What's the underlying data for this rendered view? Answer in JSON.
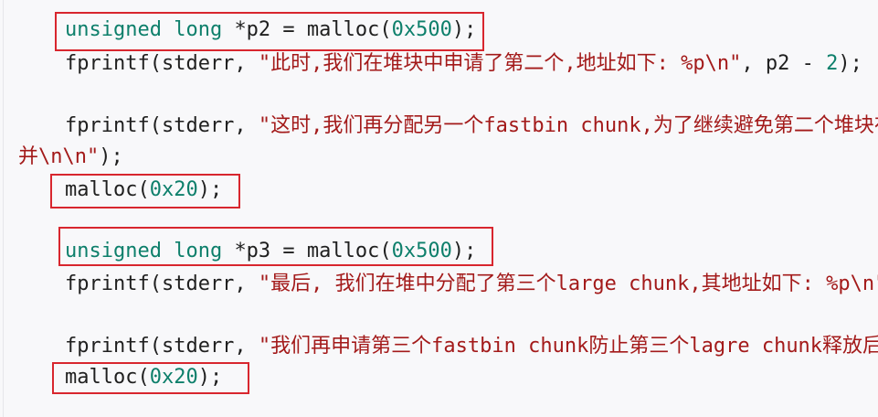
{
  "code_lines": [
    {
      "parts": [
        {
          "t": "unsigned long ",
          "c": "kw"
        },
        {
          "t": "*p2 = malloc(",
          "c": "plain"
        },
        {
          "t": "0x500",
          "c": "num"
        },
        {
          "t": ");",
          "c": "plain"
        }
      ]
    },
    {
      "parts": [
        {
          "t": "fprintf(stderr, ",
          "c": "plain"
        },
        {
          "t": "\"此时,我们在堆块中申请了第二个,地址如下: %p\\n\"",
          "c": "str"
        },
        {
          "t": ", p2 - ",
          "c": "plain"
        },
        {
          "t": "2",
          "c": "num"
        },
        {
          "t": ");",
          "c": "plain"
        }
      ]
    },
    {
      "parts": [
        {
          "t": "fprintf(stderr, ",
          "c": "plain"
        },
        {
          "t": "\"这时,我们再分配另一个fastbin chunk,为了继续避免第二个堆块在",
          "c": "str"
        }
      ]
    },
    {
      "parts": [
        {
          "t": "并\\n\\n\"",
          "c": "str"
        },
        {
          "t": ");",
          "c": "plain"
        }
      ]
    },
    {
      "parts": [
        {
          "t": "malloc(",
          "c": "plain"
        },
        {
          "t": "0x20",
          "c": "num"
        },
        {
          "t": ");",
          "c": "plain"
        }
      ]
    },
    {
      "parts": [
        {
          "t": "unsigned long ",
          "c": "kw"
        },
        {
          "t": "*p3 = malloc(",
          "c": "plain"
        },
        {
          "t": "0x500",
          "c": "num"
        },
        {
          "t": ");",
          "c": "plain"
        }
      ]
    },
    {
      "parts": [
        {
          "t": "fprintf(stderr, ",
          "c": "plain"
        },
        {
          "t": "\"最后, 我们在堆中分配了第三个large chunk,其地址如下: %p\\n\"",
          "c": "str"
        },
        {
          "t": ",",
          "c": "plain"
        }
      ]
    },
    {
      "parts": [
        {
          "t": "fprintf(stderr, ",
          "c": "plain"
        },
        {
          "t": "\"我们再申请第三个fastbin chunk防止第三个lagre chunk释放后与",
          "c": "str"
        }
      ]
    },
    {
      "parts": [
        {
          "t": "malloc(",
          "c": "plain"
        },
        {
          "t": "0x20",
          "c": "num"
        },
        {
          "t": ");",
          "c": "plain"
        }
      ]
    }
  ]
}
